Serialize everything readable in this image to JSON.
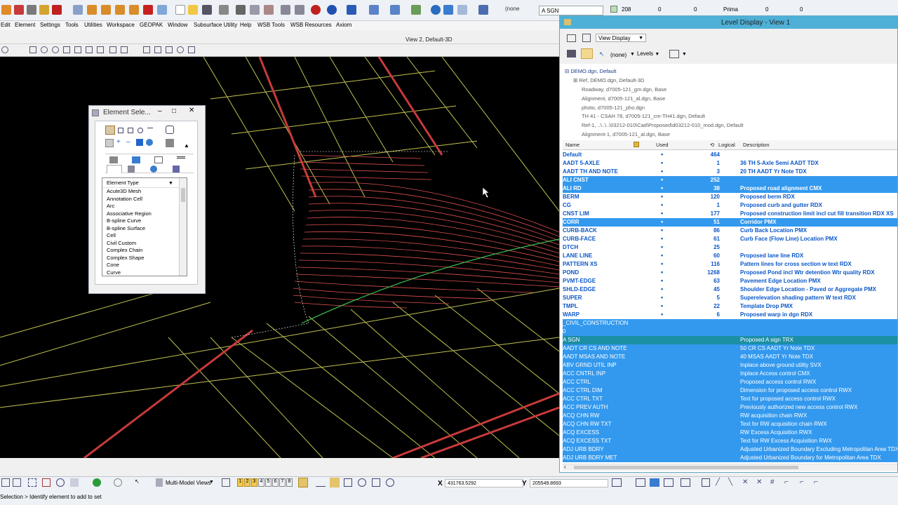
{
  "toolbar": {
    "level_combo": "A SGN",
    "color_value": "208",
    "style_value": "0",
    "weight_value": "0",
    "class_value": "Prima",
    "transparency_value": "0",
    "priority_value": "0",
    "none_label": "(none"
  },
  "menu": [
    "Edit",
    "Element",
    "Settings",
    "Tools",
    "Utilities",
    "Workspace",
    "GEOPAK",
    "Window",
    "Subsurface Utility",
    "Help",
    "WSB Tools",
    "WSB Resources",
    "Axiom"
  ],
  "view": {
    "title": "View 2, Default-3D"
  },
  "element_selection": {
    "title": "Element Sele...",
    "list_header": "Element Type",
    "items": [
      "Acute3D Mesh",
      "Annotation Cell",
      "Arc",
      "Associative Region",
      "B-spline Curve",
      "B-spline Surface",
      "Cell",
      "Civil Custom",
      "Complex Chain",
      "Complex Shape",
      "Cone",
      "Curve"
    ]
  },
  "level_display": {
    "title": "Level Display - View 1",
    "view_display": "View Display",
    "none_label": "(none)",
    "levels_label": "Levels",
    "tree": [
      "DEMO.dgn, Default",
      "Ref, DEMO.dgn, Default-3D",
      "Roadway, d7005-121_gm.dgn, Base",
      "Alignment, d7005-121_al.dgn, Base",
      "photo, d7005-121_pho.dgn",
      "TH 41 - CSAH 78, d7005-121_cm-TH41.dgn, Default",
      "Ref-1, ..\\..\\..\\03212-010\\Cad\\Proposed\\d03212-010_mod.dgn, Default",
      "Alignment-1, d7005-121_al.dgn, Base"
    ],
    "columns": {
      "name": "Name",
      "used": "Used",
      "logical": "Logical",
      "description": "Description"
    },
    "rows": [
      {
        "name": "Default",
        "used": "•",
        "count": "464",
        "desc": ""
      },
      {
        "name": "AADT 5-AXLE",
        "used": "•",
        "count": "1",
        "desc": "36 TH 5-Axle Semi AADT TDX"
      },
      {
        "name": "AADT TH AND NOTE",
        "used": "•",
        "count": "3",
        "desc": "20 TH AADT  Yr Note TDX"
      },
      {
        "name": "ALI CNST",
        "used": "•",
        "count": "252",
        "desc": ""
      },
      {
        "name": "ALI RD",
        "used": "•",
        "count": "38",
        "desc": "Proposed road alignment CMX"
      },
      {
        "name": "BERM",
        "used": "•",
        "count": "120",
        "desc": "Proposed berm RDX"
      },
      {
        "name": "CG",
        "used": "•",
        "count": "1",
        "desc": "Proposed curb and gutter RDX"
      },
      {
        "name": "CNST LIM",
        "used": "•",
        "count": "177",
        "desc": "Proposed construction limit incl cut fill transition RDX XS"
      },
      {
        "name": "CORR",
        "used": "•",
        "count": "51",
        "desc": "Corridor PMX"
      },
      {
        "name": "CURB-BACK",
        "used": "•",
        "count": "86",
        "desc": "Curb Back Location PMX"
      },
      {
        "name": "CURB-FACE",
        "used": "•",
        "count": "61",
        "desc": "Curb Face (Flow Line) Location PMX"
      },
      {
        "name": "DTCH",
        "used": "•",
        "count": "25",
        "desc": ""
      },
      {
        "name": "LANE LINE",
        "used": "•",
        "count": "60",
        "desc": "Proposed lane line RDX"
      },
      {
        "name": "PATTERN XS",
        "used": "•",
        "count": "116",
        "desc": "Pattern lines for cross section w text RDX"
      },
      {
        "name": "POND",
        "used": "•",
        "count": "1268",
        "desc": "Proposed Pond incl Wtr detention Wtr quality RDX"
      },
      {
        "name": "PVMT-EDGE",
        "used": "•",
        "count": "63",
        "desc": "Pavement Edge Location PMX"
      },
      {
        "name": "SHLD-EDGE",
        "used": "•",
        "count": "45",
        "desc": "Shoulder Edge Location - Paved or Aggregate PMX"
      },
      {
        "name": "SUPER",
        "used": "•",
        "count": "5",
        "desc": "Superelevation shading pattern W text RDX"
      },
      {
        "name": "TMPL",
        "used": "•",
        "count": "22",
        "desc": "Template Drop PMX"
      },
      {
        "name": "WARP",
        "used": "•",
        "count": "6",
        "desc": "Proposed warp in dgn RDX"
      },
      {
        "name": "_CIVIL_CONSTRUCTION",
        "used": "",
        "count": "",
        "desc": ""
      },
      {
        "name": "0",
        "used": "",
        "count": "",
        "desc": ""
      },
      {
        "name": "A SGN",
        "used": "",
        "count": "",
        "desc": "Proposed A sign TRX"
      },
      {
        "name": "AADT CR CS AND NOTE",
        "used": "",
        "count": "",
        "desc": "50 CR CS AADT  Yr Note TDX"
      },
      {
        "name": "AADT MSAS AND NOTE",
        "used": "",
        "count": "",
        "desc": "40 MSAS AADT  Yr Note TDX"
      },
      {
        "name": "ABV GRND UTIL INP",
        "used": "",
        "count": "",
        "desc": "Inplace above ground utility  SVX"
      },
      {
        "name": "ACC CNTRL INP",
        "used": "",
        "count": "",
        "desc": "Inplace Access control CMX"
      },
      {
        "name": "ACC CTRL",
        "used": "",
        "count": "",
        "desc": "Proposed access control RWX"
      },
      {
        "name": "ACC CTRL DIM",
        "used": "",
        "count": "",
        "desc": "Dimension for proposed access control RWX"
      },
      {
        "name": "ACC CTRL TXT",
        "used": "",
        "count": "",
        "desc": "Text for proposed access control RWX"
      },
      {
        "name": "ACC PREV AUTH",
        "used": "",
        "count": "",
        "desc": "Previously authorized new access control RWX"
      },
      {
        "name": "ACQ CHN RW",
        "used": "",
        "count": "",
        "desc": "RW acquisition chain RWX"
      },
      {
        "name": "ACQ CHN RW TXT",
        "used": "",
        "count": "",
        "desc": "Text for RW acquisition chain RWX"
      },
      {
        "name": "ACQ EXCESS",
        "used": "",
        "count": "",
        "desc": "RW Excess Acquisition RWX"
      },
      {
        "name": "ACQ EXCESS TXT",
        "used": "",
        "count": "",
        "desc": "Text for RW Excess Acquisition RWX"
      },
      {
        "name": "ADJ URB BDRY",
        "used": "",
        "count": "",
        "desc": "Adjusted Urbanized Boundary Excluding Metropolitan Area TDX"
      },
      {
        "name": "ADJ URB BDRY MET",
        "used": "",
        "count": "",
        "desc": "Adjusted Urbanized Boundary for Metropolitan Area TDX"
      }
    ]
  },
  "status": {
    "multi_model_views": "Multi-Model Views",
    "view_numbers": [
      "1",
      "2",
      "3",
      "4",
      "5",
      "6",
      "7",
      "8"
    ],
    "x_label": "X",
    "x_value": "431763.5292",
    "y_label": "Y",
    "y_value": "205549.8693",
    "prompt": "Selection > Identify element to add to set"
  },
  "colors": {
    "selected_row": "#3399ee",
    "active_row": "#1b8fa6",
    "level_text": "#0a57c9",
    "canvas": "#000000",
    "titlebar": "#4fb0d7"
  }
}
